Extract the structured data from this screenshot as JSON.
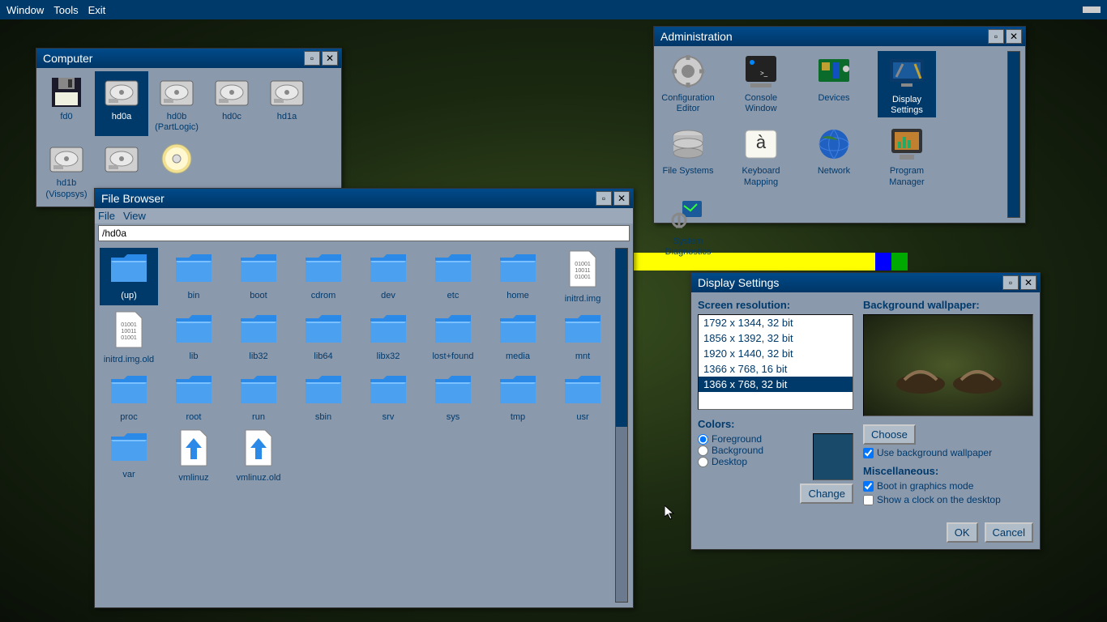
{
  "menubar": {
    "window": "Window",
    "tools": "Tools",
    "exit": "Exit"
  },
  "computer": {
    "title": "Computer",
    "drives": [
      {
        "name": "fd0",
        "type": "floppy"
      },
      {
        "name": "hd0a",
        "type": "hdd",
        "selected": true
      },
      {
        "name": "hd0b (PartLogic)",
        "type": "hdd"
      },
      {
        "name": "hd0c",
        "type": "hdd"
      },
      {
        "name": "hd1a",
        "type": "hdd"
      },
      {
        "name": "hd1b (Visopsys)",
        "type": "hdd"
      },
      {
        "name": "",
        "type": "hdd"
      },
      {
        "name": "",
        "type": "cd"
      }
    ]
  },
  "filebrowser": {
    "title": "File Browser",
    "menu_file": "File",
    "menu_view": "View",
    "path": "/hd0a",
    "items": [
      {
        "name": "(up)",
        "type": "folder",
        "selected": true
      },
      {
        "name": "bin",
        "type": "folder"
      },
      {
        "name": "boot",
        "type": "folder"
      },
      {
        "name": "cdrom",
        "type": "folder"
      },
      {
        "name": "dev",
        "type": "folder"
      },
      {
        "name": "etc",
        "type": "folder"
      },
      {
        "name": "home",
        "type": "folder"
      },
      {
        "name": "initrd.img",
        "type": "file"
      },
      {
        "name": "initrd.img.old",
        "type": "file"
      },
      {
        "name": "lib",
        "type": "folder"
      },
      {
        "name": "lib32",
        "type": "folder"
      },
      {
        "name": "lib64",
        "type": "folder"
      },
      {
        "name": "libx32",
        "type": "folder"
      },
      {
        "name": "lost+found",
        "type": "folder"
      },
      {
        "name": "media",
        "type": "folder"
      },
      {
        "name": "mnt",
        "type": "folder"
      },
      {
        "name": "proc",
        "type": "folder"
      },
      {
        "name": "root",
        "type": "folder"
      },
      {
        "name": "run",
        "type": "folder"
      },
      {
        "name": "sbin",
        "type": "folder"
      },
      {
        "name": "srv",
        "type": "folder"
      },
      {
        "name": "sys",
        "type": "folder"
      },
      {
        "name": "tmp",
        "type": "folder"
      },
      {
        "name": "usr",
        "type": "folder"
      },
      {
        "name": "var",
        "type": "folder"
      },
      {
        "name": "vmlinuz",
        "type": "arrow"
      },
      {
        "name": "vmlinuz.old",
        "type": "arrow"
      }
    ]
  },
  "admin": {
    "title": "Administration",
    "items": [
      {
        "name": "Configuration Editor"
      },
      {
        "name": "Console Window"
      },
      {
        "name": "Devices"
      },
      {
        "name": "Display Settings",
        "selected": true
      },
      {
        "name": "File Systems"
      },
      {
        "name": "Keyboard Mapping"
      },
      {
        "name": "Network"
      },
      {
        "name": "Program Manager"
      },
      {
        "name": "System Diagnostics"
      }
    ]
  },
  "display": {
    "title": "Display Settings",
    "resolution_label": "Screen resolution:",
    "resolutions": [
      "1792 x 1344, 32 bit",
      "1856 x 1392, 32 bit",
      "1920 x 1440, 32 bit",
      "1366 x 768, 16 bit",
      "1366 x 768, 32 bit"
    ],
    "selected_resolution": 4,
    "colors_label": "Colors:",
    "color_fg": "Foreground",
    "color_bg": "Background",
    "color_dt": "Desktop",
    "change_btn": "Change",
    "wallpaper_label": "Background wallpaper:",
    "choose_btn": "Choose",
    "use_wallpaper": "Use background wallpaper",
    "misc_label": "Miscellaneous:",
    "boot_graphics": "Boot in graphics mode",
    "show_clock": "Show a clock on the desktop",
    "ok_btn": "OK",
    "cancel_btn": "Cancel"
  }
}
